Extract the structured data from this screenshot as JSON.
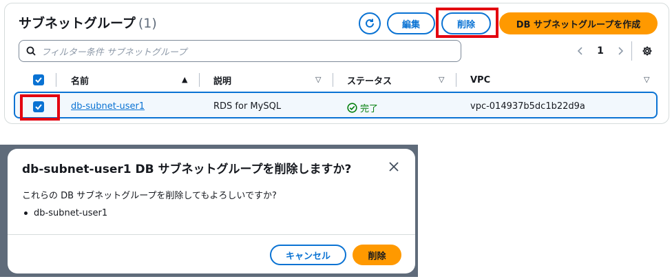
{
  "header": {
    "title": "サブネットグループ",
    "count": "(1)",
    "refresh_icon": "refresh-icon",
    "edit_label": "編集",
    "delete_label": "削除",
    "create_label": "DB サブネットグループを作成"
  },
  "search": {
    "placeholder": "フィルター条件 サブネットグループ"
  },
  "pagination": {
    "prev": "‹",
    "page": "1",
    "next": "›"
  },
  "table": {
    "columns": [
      "名前",
      "説明",
      "ステータス",
      "VPC"
    ],
    "rows": [
      {
        "selected": true,
        "name": "db-subnet-user1",
        "description": "RDS for MySQL",
        "status": "完了",
        "vpc": "vpc-014937b5dc1b22d9a"
      }
    ]
  },
  "modal": {
    "title": "db-subnet-user1 DB サブネットグループを削除しますか?",
    "body": "これらの DB サブネットグループを削除してもよろしいですか?",
    "items": [
      "db-subnet-user1"
    ],
    "cancel_label": "キャンセル",
    "confirm_label": "削除"
  },
  "colors": {
    "accent": "#0972d3",
    "primary_button": "#ff9900",
    "success": "#037f0c",
    "highlight": "#e3000f"
  }
}
